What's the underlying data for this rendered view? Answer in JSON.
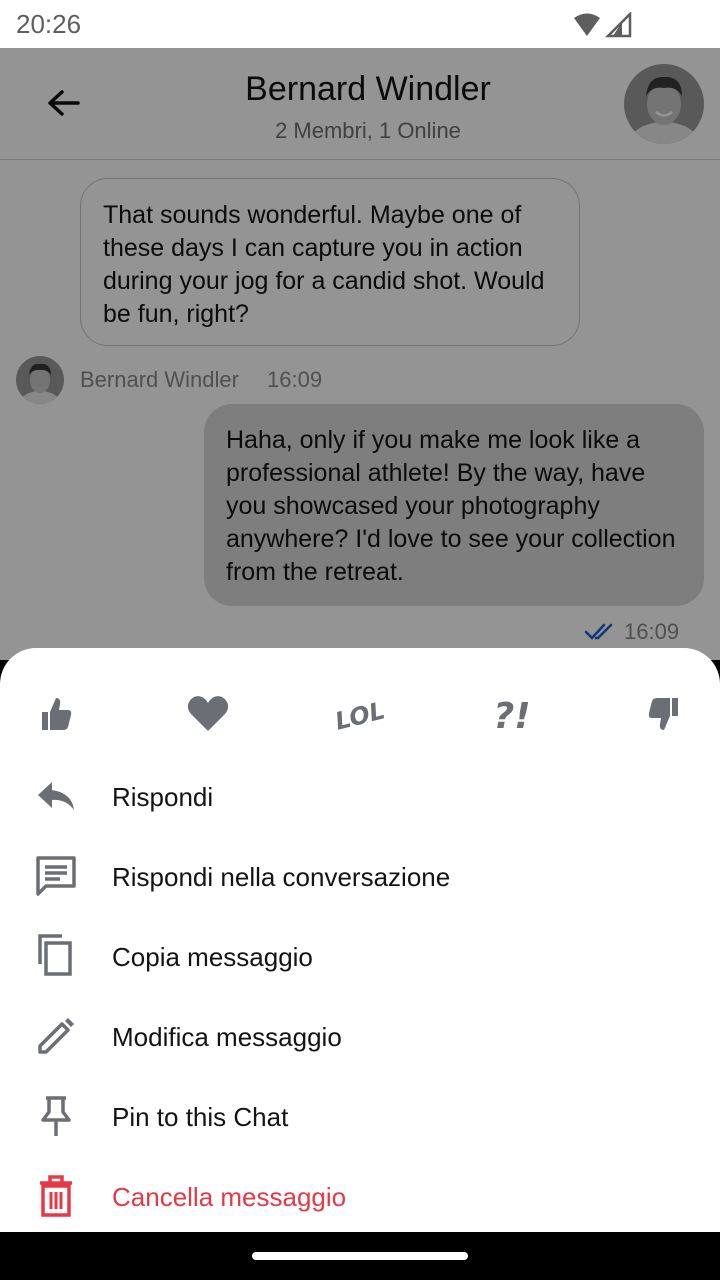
{
  "status_bar": {
    "time": "20:26"
  },
  "header": {
    "title": "Bernard Windler",
    "subtitle": "2 Membri, 1 Online"
  },
  "messages": [
    {
      "direction": "incoming",
      "text": "That sounds wonderful. Maybe one of these days I can capture you in action during your jog for a candid shot. Would be fun, right?",
      "sender": "Bernard Windler",
      "time": "16:09"
    },
    {
      "direction": "outgoing",
      "text": "Haha, only if you make me look like a professional athlete! By the way, have you showcased your photography anywhere? I'd love to see your collection from the retreat.",
      "time": "16:09",
      "receipt": "read"
    }
  ],
  "reactions": [
    {
      "icon": "thumbs-up-icon"
    },
    {
      "icon": "heart-icon"
    },
    {
      "icon": "lol-icon",
      "text": "LOL"
    },
    {
      "icon": "wow-icon",
      "text": "?!"
    },
    {
      "icon": "thumbs-down-icon"
    }
  ],
  "actions": [
    {
      "icon": "reply-icon",
      "label": "Rispondi"
    },
    {
      "icon": "thread-reply-icon",
      "label": "Rispondi nella conversazione"
    },
    {
      "icon": "copy-icon",
      "label": "Copia messaggio"
    },
    {
      "icon": "edit-icon",
      "label": "Modifica messaggio"
    },
    {
      "icon": "pin-icon",
      "label": "Pin to this Chat"
    },
    {
      "icon": "delete-icon",
      "label": "Cancella messaggio",
      "style": "danger"
    }
  ],
  "colors": {
    "icon_gray": "#6b6f75",
    "danger": "#e53945",
    "read_tick": "#1a5fd6",
    "outgoing_bubble": "#dadada"
  }
}
